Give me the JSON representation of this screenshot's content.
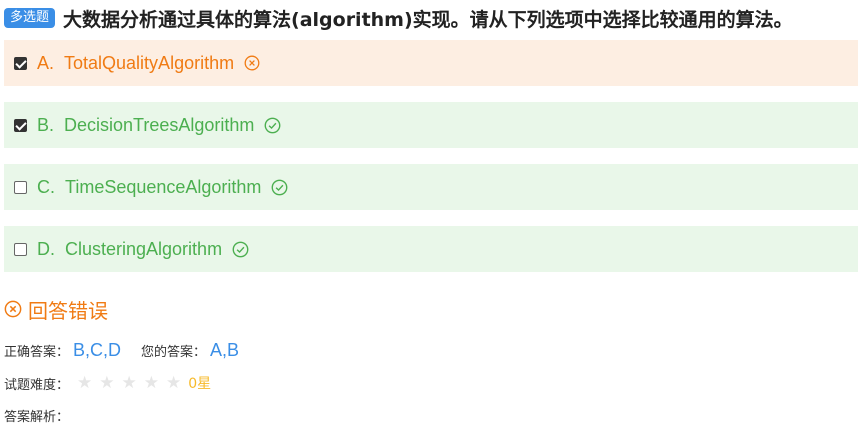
{
  "question": {
    "type_badge": "多选题",
    "text": "大数据分析通过具体的算法(algorithm)实现。请从下列选项中选择比较通用的算法。"
  },
  "options": [
    {
      "letter": "A.",
      "text": "TotalQualityAlgorithm",
      "checked": true,
      "status": "wrong"
    },
    {
      "letter": "B.",
      "text": "DecisionTreesAlgorithm",
      "checked": true,
      "status": "correct"
    },
    {
      "letter": "C.",
      "text": "TimeSequenceAlgorithm",
      "checked": false,
      "status": "correct"
    },
    {
      "letter": "D.",
      "text": "ClusteringAlgorithm",
      "checked": false,
      "status": "correct"
    }
  ],
  "result": {
    "text": "回答错误",
    "icon": "close-circle-icon"
  },
  "answers": {
    "correct_label": "正确答案：",
    "correct_value": "B,C,D",
    "yours_label": "您的答案：",
    "yours_value": "A,B"
  },
  "difficulty": {
    "label": "试题难度：",
    "stars_total": 5,
    "stars_filled": 0,
    "value_text": "0星"
  },
  "analysis": {
    "label": "答案解析："
  },
  "colors": {
    "badge": "#3a8ee6",
    "wrong": "#f07b14",
    "correct": "#4caf50",
    "wrong_bg": "#fdeee2",
    "correct_bg": "#e9f7e9",
    "answer_value": "#3a8ee6",
    "star_empty": "#e6e6e6",
    "star_value": "#f7ba2a"
  }
}
